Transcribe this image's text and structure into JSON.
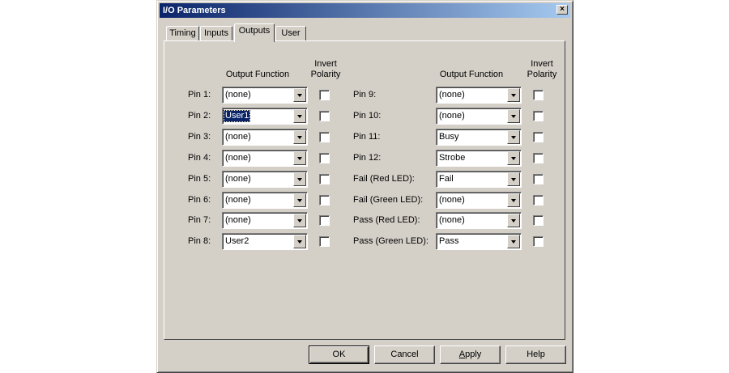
{
  "window": {
    "title": "I/O Parameters",
    "close_glyph": "×"
  },
  "tabs": [
    {
      "label": "Timing",
      "active": false
    },
    {
      "label": "Inputs",
      "active": false
    },
    {
      "label": "Outputs",
      "active": true
    },
    {
      "label": "User",
      "active": false
    }
  ],
  "headers": {
    "output_function": "Output Function",
    "invert_line1": "Invert",
    "invert_line2": "Polarity"
  },
  "left_pins": [
    {
      "label": "Pin 1:",
      "value": "(none)",
      "inverted": false
    },
    {
      "label": "Pin 2:",
      "value": "User1",
      "inverted": false,
      "focused": true
    },
    {
      "label": "Pin 3:",
      "value": "(none)",
      "inverted": false
    },
    {
      "label": "Pin 4:",
      "value": "(none)",
      "inverted": false
    },
    {
      "label": "Pin 5:",
      "value": "(none)",
      "inverted": false
    },
    {
      "label": "Pin 6:",
      "value": "(none)",
      "inverted": false
    },
    {
      "label": "Pin 7:",
      "value": "(none)",
      "inverted": false
    },
    {
      "label": "Pin 8:",
      "value": "User2",
      "inverted": false
    }
  ],
  "right_pins": [
    {
      "label": "Pin 9:",
      "value": "(none)",
      "inverted": false
    },
    {
      "label": "Pin 10:",
      "value": "(none)",
      "inverted": false
    },
    {
      "label": "Pin 11:",
      "value": "Busy",
      "inverted": false
    },
    {
      "label": "Pin 12:",
      "value": "Strobe",
      "inverted": false
    },
    {
      "label": "Fail (Red LED):",
      "value": "Fail",
      "inverted": false
    },
    {
      "label": "Fail (Green LED):",
      "value": "(none)",
      "inverted": false
    },
    {
      "label": "Pass (Red LED):",
      "value": "(none)",
      "inverted": false
    },
    {
      "label": "Pass (Green LED):",
      "value": "Pass",
      "inverted": false
    }
  ],
  "buttons": {
    "ok": "OK",
    "cancel": "Cancel",
    "apply_prefix": "",
    "apply_accel": "A",
    "apply_rest": "pply",
    "help": "Help"
  },
  "colors": {
    "face": "#d4d0c8",
    "title_start": "#0a246a",
    "title_end": "#a6caf0",
    "selection": "#0a246a"
  }
}
